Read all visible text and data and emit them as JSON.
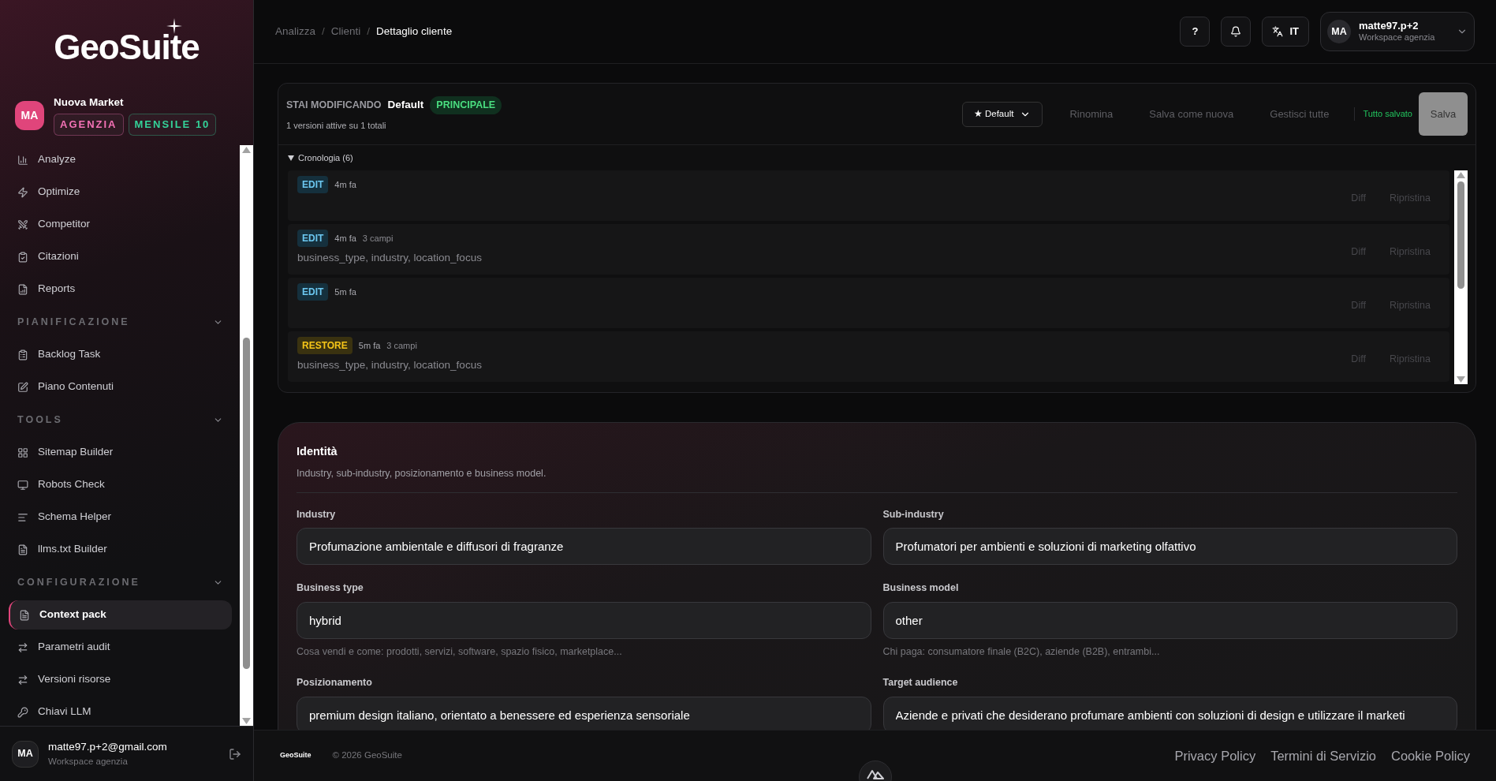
{
  "brand": {
    "logo": "GeoSuite"
  },
  "workspace": {
    "avatar": "MA",
    "name": "Nuova Market",
    "badges": [
      {
        "label": "AGENZIA",
        "color": "#f472b6"
      },
      {
        "label": "MENSILE 10",
        "color": "#34d399"
      }
    ]
  },
  "nav_top": [
    {
      "label": "Analyze",
      "selected": false
    },
    {
      "label": "Optimize",
      "selected": false
    },
    {
      "label": "Competitor",
      "selected": false
    },
    {
      "label": "Citazioni",
      "selected": false
    },
    {
      "label": "Reports",
      "selected": false
    }
  ],
  "nav_sections": [
    {
      "title": "PIANIFICAZIONE",
      "expanded": true,
      "items": [
        {
          "label": "Backlog Task",
          "selected": false
        },
        {
          "label": "Piano Contenuti",
          "selected": false
        }
      ]
    },
    {
      "title": "TOOLS",
      "expanded": true,
      "items": [
        {
          "label": "Sitemap Builder",
          "selected": false
        },
        {
          "label": "Robots Check",
          "selected": false
        },
        {
          "label": "Schema Helper",
          "selected": false
        },
        {
          "label": "llms.txt Builder",
          "selected": false
        }
      ]
    },
    {
      "title": "CONFIGURAZIONE",
      "expanded": true,
      "items": [
        {
          "label": "Context pack",
          "selected": true
        },
        {
          "label": "Parametri audit",
          "selected": false
        },
        {
          "label": "Versioni risorse",
          "selected": false
        },
        {
          "label": "Chiavi LLM",
          "selected": false
        }
      ]
    }
  ],
  "user": {
    "avatar": "MA",
    "email": "matte97.p+2@gmail.com",
    "workspace": "Workspace agenzia"
  },
  "breadcrumb_separator": "/",
  "breadcrumb": [
    {
      "label": "Analizza",
      "selected": false
    },
    {
      "label": "Clienti",
      "selected": false
    },
    {
      "label": "Dettaglio cliente",
      "selected": true
    }
  ],
  "header": {
    "help": "?",
    "language": "IT",
    "account": {
      "avatar": "MA",
      "name": "matte97.p+2",
      "workspace": "Workspace agenzia"
    }
  },
  "version_panel": {
    "editing_label": "STAI MODIFICANDO",
    "version_name": "Default",
    "badge": "PRINCIPALE",
    "summary": "1 versioni attive su 1 totali",
    "select": "★ Default",
    "actions": [
      "Rinomina",
      "Salva come nuova",
      "Gestisci tutte"
    ],
    "status": "Tutto salvato",
    "save": {
      "label": "Salva",
      "disabled": true
    },
    "history": {
      "title": "Cronologia (6)",
      "expanded": true,
      "entries": [
        {
          "kind": "edit",
          "tag": "EDIT",
          "time": "4m fa",
          "diff": "Diff",
          "restore": "Ripristina"
        },
        {
          "kind": "edit",
          "tag": "EDIT",
          "time": "4m fa",
          "count": "3 campi",
          "fields": "business_type, industry, location_focus",
          "diff": "Diff",
          "restore": "Ripristina"
        },
        {
          "kind": "edit",
          "tag": "EDIT",
          "time": "5m fa",
          "diff": "Diff",
          "restore": "Ripristina"
        },
        {
          "kind": "restore",
          "tag": "RESTORE",
          "time": "5m fa",
          "count": "3 campi",
          "fields": "business_type, industry, location_focus",
          "diff": "Diff",
          "restore": "Ripristina"
        }
      ]
    }
  },
  "identity": {
    "title": "Identità",
    "subtitle": "Industry, sub-industry, posizionamento e business model.",
    "fields": [
      {
        "label": "Industry",
        "value": "Profumazione ambientale e diffusori di fragranze"
      },
      {
        "label": "Sub-industry",
        "value": "Profumatori per ambienti e soluzioni di marketing olfattivo"
      },
      {
        "label": "Business type",
        "value": "hybrid",
        "hint": "Cosa vendi e come: prodotti, servizi, software, spazio fisico, marketplace..."
      },
      {
        "label": "Business model",
        "value": "other",
        "hint": "Chi paga: consumatore finale (B2C), aziende (B2B), entrambi..."
      },
      {
        "label": "Posizionamento",
        "value": "premium design italiano, orientato a benessere ed esperienza sensoriale"
      },
      {
        "label": "Target audience",
        "value": "Aziende e privati che desiderano profumare ambienti con soluzioni di design e utilizzare il marketi"
      }
    ]
  },
  "footer": {
    "logo": "GeoSuite",
    "copyright": "© 2026 GeoSuite",
    "links": [
      "Privacy Policy",
      "Termini di Servizio",
      "Cookie Policy"
    ]
  }
}
